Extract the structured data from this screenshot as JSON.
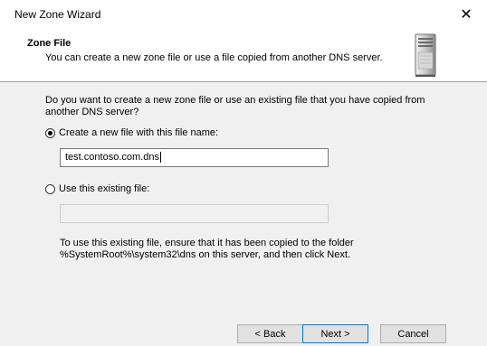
{
  "window": {
    "title": "New Zone Wizard",
    "close_glyph": "✕"
  },
  "header": {
    "title": "Zone File",
    "subtitle": "You can create a new zone file or use a file copied from another DNS server.",
    "icon": "server-icon"
  },
  "body": {
    "question": "Do you want to create a new zone file or use an existing file that you have copied from another DNS server?",
    "option_new": {
      "label": "Create a new file with this file name:",
      "selected": true,
      "value": "test.contoso.com.dns"
    },
    "option_existing": {
      "label": "Use this existing file:",
      "selected": false,
      "value": ""
    },
    "note_line1": "To use this existing file, ensure that it has been copied to the folder",
    "note_line2": "%SystemRoot%\\system32\\dns on this server, and then click Next."
  },
  "buttons": {
    "back": "< Back",
    "next": "Next >",
    "cancel": "Cancel"
  },
  "colors": {
    "accent": "#0078d7",
    "content_bg": "#f0f0f0"
  }
}
